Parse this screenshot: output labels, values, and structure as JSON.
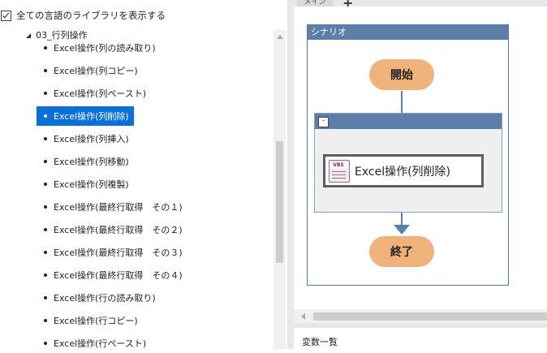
{
  "library": {
    "show_all_label": "全ての言語のライブラリを表示する",
    "show_all_checked": true,
    "group_label": "03_行列操作",
    "items": [
      {
        "label": "Excel操作(列の読み取り)",
        "selected": false
      },
      {
        "label": "Excel操作(列コピー)",
        "selected": false
      },
      {
        "label": "Excel操作(列ペースト)",
        "selected": false
      },
      {
        "label": "Excel操作(列削除)",
        "selected": true
      },
      {
        "label": "Excel操作(列挿入)",
        "selected": false
      },
      {
        "label": "Excel操作(列移動)",
        "selected": false
      },
      {
        "label": "Excel操作(列複製)",
        "selected": false
      },
      {
        "label": "Excel操作(最終行取得　その１)",
        "selected": false
      },
      {
        "label": "Excel操作(最終行取得　その２)",
        "selected": false
      },
      {
        "label": "Excel操作(最終行取得　その３)",
        "selected": false
      },
      {
        "label": "Excel操作(最終行取得　その４)",
        "selected": false
      },
      {
        "label": "Excel操作(行の読み取り)",
        "selected": false
      },
      {
        "label": "Excel操作(行コピー)",
        "selected": false
      },
      {
        "label": "Excel操作(行ペースト)",
        "selected": false
      }
    ]
  },
  "designer": {
    "tab_label": "メイン",
    "add_tab_label": "+",
    "scenario_title": "シナリオ",
    "start_label": "開始",
    "end_label": "終了",
    "collapse_label": "-",
    "activity_label": "Excel操作(列削除)",
    "activity_icon": "vbs-script-icon",
    "activity_icon_text": "VBS"
  },
  "bottom_panel": {
    "title": "変数一覧"
  },
  "colors": {
    "selection": "#0a6fd6",
    "scenario_header": "#5b7fa9",
    "terminal_node": "#f0b27b"
  }
}
